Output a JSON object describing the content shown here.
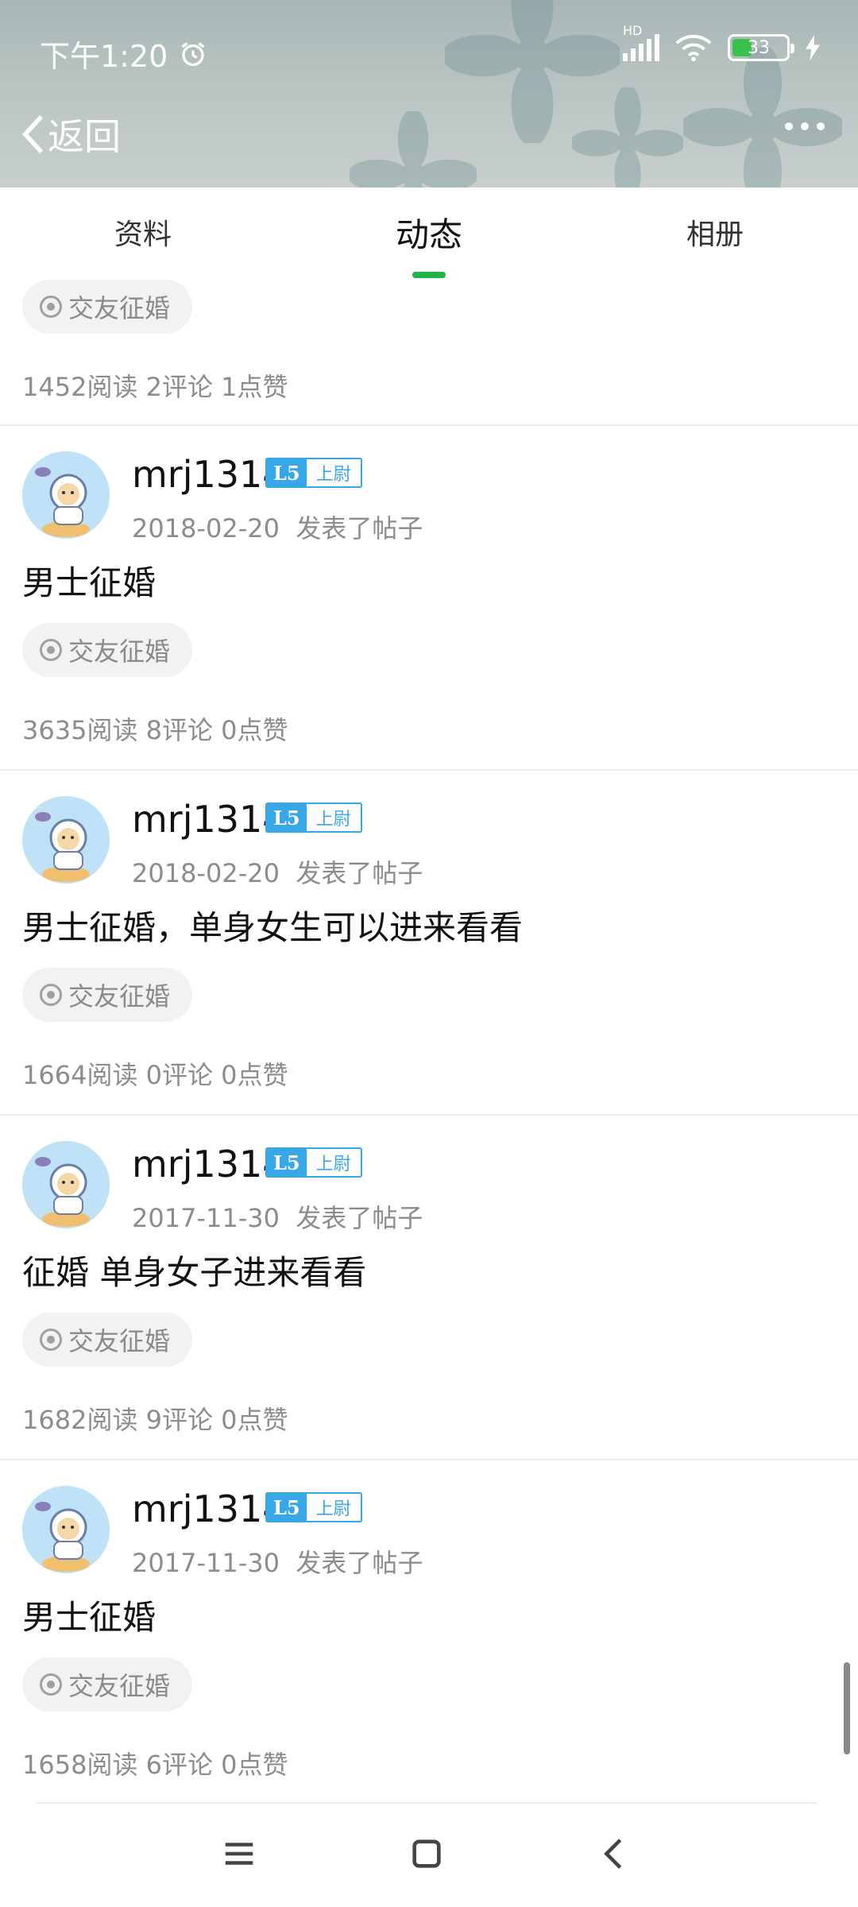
{
  "status_bar": {
    "time": "下午1:20",
    "network": "HD",
    "battery": "33"
  },
  "nav": {
    "back_label": "返回"
  },
  "tabs": [
    {
      "label": "资料"
    },
    {
      "label": "动态",
      "active": true
    },
    {
      "label": "相册"
    }
  ],
  "top_partial_post": {
    "tag": "交友征婚",
    "stats": "1452阅读 2评论 1点赞"
  },
  "posts": [
    {
      "username": "mrj1314",
      "level": "L5",
      "rank": "上尉",
      "date": "2018-02-20",
      "action": "发表了帖子",
      "title": "男士征婚",
      "tag": "交友征婚",
      "stats": "3635阅读 8评论 0点赞"
    },
    {
      "username": "mrj1314",
      "level": "L5",
      "rank": "上尉",
      "date": "2018-02-20",
      "action": "发表了帖子",
      "title": "男士征婚，单身女生可以进来看看",
      "tag": "交友征婚",
      "stats": "1664阅读 0评论 0点赞"
    },
    {
      "username": "mrj1314",
      "level": "L5",
      "rank": "上尉",
      "date": "2017-11-30",
      "action": "发表了帖子",
      "title": "征婚 单身女子进来看看",
      "tag": "交友征婚",
      "stats": "1682阅读 9评论 0点赞"
    },
    {
      "username": "mrj1314",
      "level": "L5",
      "rank": "上尉",
      "date": "2017-11-30",
      "action": "发表了帖子",
      "title": "男士征婚",
      "tag": "交友征婚",
      "stats": "1658阅读 6评论 0点赞"
    }
  ],
  "colors": {
    "accent": "#1fb34a",
    "badge": "#38a7e8",
    "muted_text": "#8c8c8c"
  }
}
